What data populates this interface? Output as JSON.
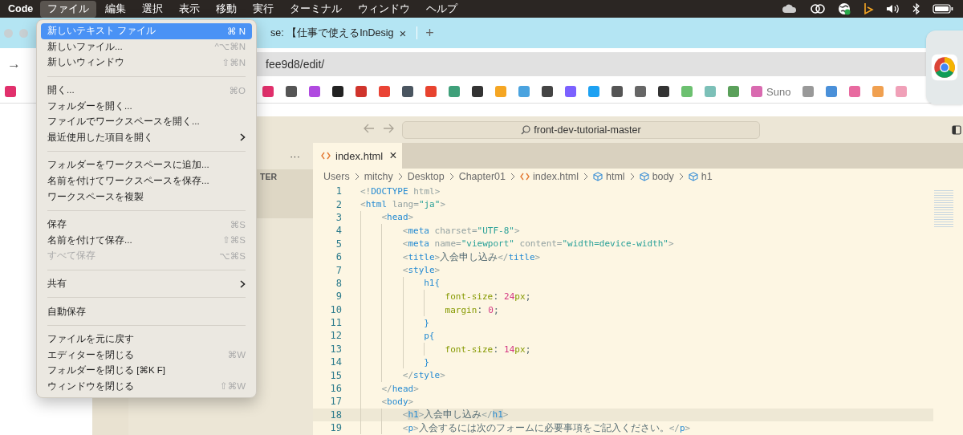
{
  "menu_bar": {
    "app_name": "Code",
    "items": [
      {
        "label": "ファイル",
        "selected": true
      },
      {
        "label": "編集",
        "selected": false
      },
      {
        "label": "選択",
        "selected": false
      },
      {
        "label": "表示",
        "selected": false
      },
      {
        "label": "移動",
        "selected": false
      },
      {
        "label": "実行",
        "selected": false
      },
      {
        "label": "ターミナル",
        "selected": false
      },
      {
        "label": "ウィンドウ",
        "selected": false
      },
      {
        "label": "ヘルプ",
        "selected": false
      }
    ]
  },
  "file_menu": [
    {
      "kind": "item",
      "label": "新しいテキスト ファイル",
      "shortcut": "⌘ N",
      "selected": true,
      "disabled": false,
      "submenu": false
    },
    {
      "kind": "item",
      "label": "新しいファイル...",
      "shortcut": "^⌥⌘N",
      "selected": false,
      "disabled": false,
      "submenu": false
    },
    {
      "kind": "item",
      "label": "新しいウィンドウ",
      "shortcut": "⇧⌘N",
      "selected": false,
      "disabled": false,
      "submenu": false
    },
    {
      "kind": "separator"
    },
    {
      "kind": "item",
      "label": "開く...",
      "shortcut": "⌘O",
      "selected": false,
      "disabled": false,
      "submenu": false
    },
    {
      "kind": "item",
      "label": "フォルダーを開く...",
      "selected": false,
      "disabled": false,
      "submenu": false
    },
    {
      "kind": "item",
      "label": "ファイルでワークスペースを開く...",
      "selected": false,
      "disabled": false,
      "submenu": false
    },
    {
      "kind": "item",
      "label": "最近使用した項目を開く",
      "selected": false,
      "disabled": false,
      "submenu": true
    },
    {
      "kind": "separator"
    },
    {
      "kind": "item",
      "label": "フォルダーをワークスペースに追加...",
      "selected": false,
      "disabled": false,
      "submenu": false
    },
    {
      "kind": "item",
      "label": "名前を付けてワークスペースを保存...",
      "selected": false,
      "disabled": false,
      "submenu": false
    },
    {
      "kind": "item",
      "label": "ワークスペースを複製",
      "selected": false,
      "disabled": false,
      "submenu": false
    },
    {
      "kind": "separator"
    },
    {
      "kind": "item",
      "label": "保存",
      "shortcut": "⌘S",
      "selected": false,
      "disabled": false,
      "submenu": false
    },
    {
      "kind": "item",
      "label": "名前を付けて保存...",
      "shortcut": "⇧⌘S",
      "selected": false,
      "disabled": false,
      "submenu": false
    },
    {
      "kind": "item",
      "label": "すべて保存",
      "shortcut": "⌥⌘S",
      "selected": false,
      "disabled": true,
      "submenu": false
    },
    {
      "kind": "separator"
    },
    {
      "kind": "item",
      "label": "共有",
      "selected": false,
      "disabled": false,
      "submenu": true
    },
    {
      "kind": "separator"
    },
    {
      "kind": "item",
      "label": "自動保存",
      "selected": false,
      "disabled": false,
      "submenu": false
    },
    {
      "kind": "separator"
    },
    {
      "kind": "item",
      "label": "ファイルを元に戻す",
      "selected": false,
      "disabled": false,
      "submenu": false
    },
    {
      "kind": "item",
      "label": "エディターを閉じる",
      "shortcut": "⌘W",
      "selected": false,
      "disabled": false,
      "submenu": false
    },
    {
      "kind": "item",
      "label": "フォルダーを閉じる [⌘K F]",
      "selected": false,
      "disabled": false,
      "submenu": false
    },
    {
      "kind": "item",
      "label": "ウィンドウを閉じる",
      "shortcut": "⇧⌘W",
      "selected": false,
      "disabled": false,
      "submenu": false
    }
  ],
  "browser": {
    "tab": {
      "title": "se: 【仕事で使えるInDesig",
      "close": "×"
    },
    "new_tab": "+",
    "address": "fee9d8/edit/",
    "forward": "→",
    "bookmarks": [
      {
        "color": "#e1306c"
      },
      {
        "color": "#555555"
      },
      {
        "color": "#b04ae0"
      },
      {
        "color": "#222222"
      },
      {
        "color": "#d0342c"
      },
      {
        "color": "#ea4335"
      },
      {
        "color": "#4a5560"
      },
      {
        "color": "#e8432f"
      },
      {
        "color": "#3fa07a"
      },
      {
        "color": "#333333"
      },
      {
        "color": "#f5a623"
      },
      {
        "color": "#4aa3df"
      },
      {
        "color": "#444444"
      },
      {
        "color": "#7b61ff"
      },
      {
        "color": "#1da1f2"
      },
      {
        "color": "#555555"
      },
      {
        "color": "#666666"
      },
      {
        "color": "#333333"
      }
    ],
    "more_bookmarks": [
      {
        "color": "#6cc070"
      },
      {
        "color": "#7cc0b8"
      },
      {
        "color": "#5aa05a"
      },
      {
        "color": "#d96ab0"
      }
    ],
    "suno_label": "Suno",
    "last_bookmarks": [
      {
        "color": "#999999"
      },
      {
        "color": "#4a90d9"
      },
      {
        "color": "#e86aa0"
      },
      {
        "color": "#f0a050"
      },
      {
        "color": "#f0a0b8"
      }
    ]
  },
  "editor": {
    "search": "front-dev-tutorial-master",
    "explorer_more": "···",
    "explorer_section": "TER",
    "tab": {
      "label": "index.html",
      "close": "×"
    },
    "breadcrumbs": [
      {
        "label": "Users",
        "kind": "folder"
      },
      {
        "label": "mitchy",
        "kind": "folder"
      },
      {
        "label": "Desktop",
        "kind": "folder"
      },
      {
        "label": "Chapter01",
        "kind": "folder"
      },
      {
        "label": "index.html",
        "kind": "file"
      },
      {
        "label": "html",
        "kind": "element"
      },
      {
        "label": "body",
        "kind": "element"
      },
      {
        "label": "h1",
        "kind": "element"
      }
    ],
    "lines": [
      {
        "number": "1",
        "current": false,
        "tokens": [
          {
            "kind": "p",
            "text": "<!"
          },
          {
            "kind": "tag",
            "text": "DOCTYPE"
          },
          {
            "kind": "p",
            "text": " html>"
          }
        ]
      },
      {
        "number": "2",
        "current": false,
        "tokens": [
          {
            "kind": "p",
            "text": "<"
          },
          {
            "kind": "tag",
            "text": "html"
          },
          {
            "kind": "p",
            "text": " lang="
          },
          {
            "kind": "str",
            "text": "\"ja\""
          },
          {
            "kind": "p",
            "text": ">"
          }
        ],
        "children": [
          {
            "number": "3",
            "current": false,
            "tokens": [
              {
                "kind": "p",
                "text": "<"
              },
              {
                "kind": "tag",
                "text": "head"
              },
              {
                "kind": "p",
                "text": ">"
              }
            ],
            "children": [
              {
                "number": "4",
                "current": false,
                "tokens": [
                  {
                    "kind": "p",
                    "text": "<"
                  },
                  {
                    "kind": "tag",
                    "text": "meta"
                  },
                  {
                    "kind": "p",
                    "text": " charset="
                  },
                  {
                    "kind": "str",
                    "text": "\"UTF-8\""
                  },
                  {
                    "kind": "p",
                    "text": ">"
                  }
                ]
              },
              {
                "number": "5",
                "current": false,
                "tokens": [
                  {
                    "kind": "p",
                    "text": "<"
                  },
                  {
                    "kind": "tag",
                    "text": "meta"
                  },
                  {
                    "kind": "p",
                    "text": " name="
                  },
                  {
                    "kind": "str",
                    "text": "\"viewport\""
                  },
                  {
                    "kind": "p",
                    "text": " content="
                  },
                  {
                    "kind": "str",
                    "text": "\"width=device-width\""
                  },
                  {
                    "kind": "p",
                    "text": ">"
                  }
                ]
              },
              {
                "number": "6",
                "current": false,
                "tokens": [
                  {
                    "kind": "p",
                    "text": "<"
                  },
                  {
                    "kind": "tag",
                    "text": "title"
                  },
                  {
                    "kind": "p",
                    "text": ">"
                  },
                  {
                    "kind": "txt",
                    "text": "入会申し込み"
                  },
                  {
                    "kind": "p",
                    "text": "</"
                  },
                  {
                    "kind": "tag",
                    "text": "title"
                  },
                  {
                    "kind": "p",
                    "text": ">"
                  }
                ]
              },
              {
                "number": "7",
                "current": false,
                "tokens": [
                  {
                    "kind": "p",
                    "text": "<"
                  },
                  {
                    "kind": "tag",
                    "text": "style"
                  },
                  {
                    "kind": "p",
                    "text": ">"
                  }
                ],
                "children": [
                  {
                    "number": "8",
                    "current": false,
                    "tokens": [
                      {
                        "kind": "tag",
                        "text": "h1{"
                      }
                    ],
                    "children": [
                      {
                        "number": "9",
                        "current": false,
                        "tokens": [
                          {
                            "kind": "prop",
                            "text": "font-size"
                          },
                          {
                            "kind": "txt",
                            "text": ":"
                          },
                          {
                            "kind": "num",
                            "text": " 24"
                          },
                          {
                            "kind": "prop",
                            "text": "px"
                          },
                          {
                            "kind": "txt",
                            "text": ";"
                          }
                        ]
                      },
                      {
                        "number": "10",
                        "current": false,
                        "tokens": [
                          {
                            "kind": "prop",
                            "text": "margin"
                          },
                          {
                            "kind": "txt",
                            "text": ":"
                          },
                          {
                            "kind": "num",
                            "text": " 0"
                          },
                          {
                            "kind": "txt",
                            "text": ";"
                          }
                        ]
                      }
                    ]
                  },
                  {
                    "number": "11",
                    "current": false,
                    "tokens": [
                      {
                        "kind": "tag",
                        "text": "}"
                      }
                    ]
                  },
                  {
                    "number": "12",
                    "current": false,
                    "tokens": [
                      {
                        "kind": "tag",
                        "text": "p{"
                      }
                    ],
                    "children": [
                      {
                        "number": "13",
                        "current": false,
                        "tokens": [
                          {
                            "kind": "prop",
                            "text": "font-size"
                          },
                          {
                            "kind": "txt",
                            "text": ":"
                          },
                          {
                            "kind": "num",
                            "text": " 14"
                          },
                          {
                            "kind": "prop",
                            "text": "px"
                          },
                          {
                            "kind": "txt",
                            "text": ";"
                          }
                        ]
                      }
                    ]
                  },
                  {
                    "number": "14",
                    "current": false,
                    "tokens": [
                      {
                        "kind": "tag",
                        "text": "}"
                      }
                    ]
                  }
                ]
              },
              {
                "number": "15",
                "current": false,
                "tokens": [
                  {
                    "kind": "p",
                    "text": "</"
                  },
                  {
                    "kind": "tag",
                    "text": "style"
                  },
                  {
                    "kind": "p",
                    "text": ">"
                  }
                ]
              }
            ]
          },
          {
            "number": "16",
            "current": false,
            "tokens": [
              {
                "kind": "p",
                "text": "</"
              },
              {
                "kind": "tag",
                "text": "head"
              },
              {
                "kind": "p",
                "text": ">"
              }
            ]
          },
          {
            "number": "17",
            "current": false,
            "tokens": [
              {
                "kind": "p",
                "text": "<"
              },
              {
                "kind": "tag",
                "text": "body"
              },
              {
                "kind": "p",
                "text": ">"
              }
            ],
            "children": [
              {
                "number": "18",
                "current": true,
                "tokens": [
                  {
                    "kind": "p",
                    "text": "<"
                  },
                  {
                    "kind": "match",
                    "text": "h1"
                  },
                  {
                    "kind": "p",
                    "text": ">"
                  },
                  {
                    "kind": "txt",
                    "text": "入会申し込み"
                  },
                  {
                    "kind": "p",
                    "text": "</"
                  },
                  {
                    "kind": "match",
                    "text": "h1"
                  },
                  {
                    "kind": "p",
                    "text": ">"
                  }
                ]
              },
              {
                "number": "19",
                "current": false,
                "tokens": [
                  {
                    "kind": "p",
                    "text": "<"
                  },
                  {
                    "kind": "tag",
                    "text": "p"
                  },
                  {
                    "kind": "p",
                    "text": ">"
                  },
                  {
                    "kind": "txt",
                    "text": "入会するには次のフォームに必要事項をご記入ください。"
                  },
                  {
                    "kind": "p",
                    "text": "</"
                  },
                  {
                    "kind": "tag",
                    "text": "p"
                  },
                  {
                    "kind": "p",
                    "text": ">"
                  }
                ]
              }
            ]
          }
        ]
      }
    ]
  }
}
